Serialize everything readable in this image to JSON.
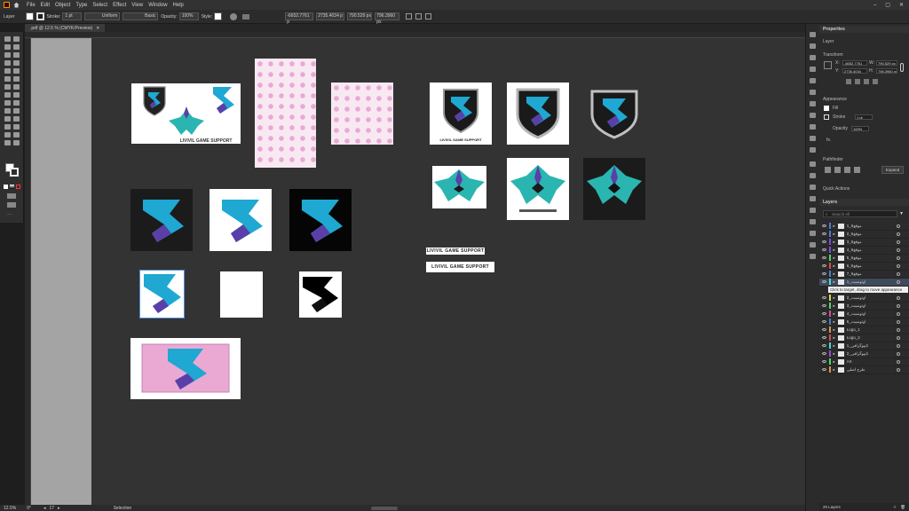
{
  "menu": {
    "app_icon": "illustrator-icon",
    "home_icon": "home-icon",
    "items": [
      "File",
      "Edit",
      "Object",
      "Type",
      "Select",
      "Effect",
      "View",
      "Window",
      "Help"
    ]
  },
  "control_bar": {
    "selection_label": "Layer",
    "stroke_label": "Stroke:",
    "stroke_value": "1 pt",
    "uniform_label": "Uniform",
    "basic_label": "Basic",
    "opacity_label": "Opacity:",
    "opacity_value": "100%",
    "style_label": "Style:",
    "x_value": "-6652.7761 p",
    "y_value": "2735.4034 p",
    "w_value": "790.529 px",
    "h_value": "796.3960 px"
  },
  "document": {
    "tab_title": ".pdf @ 12.5 % (CMYK/Preview)"
  },
  "canvas": {
    "label_small": "LIVIVIL GAME SUPPORT",
    "label_large": "LIVIVIL GAME SUPPORT",
    "banner_text": "LIVIVIL GAME SUPPORT",
    "shield_text": "LIVIVIL GAME SUPPORT"
  },
  "status_bar": {
    "zoom": "12.5%",
    "angle": "0°",
    "artboard": "17",
    "tool": "Selection"
  },
  "properties_panel": {
    "tab": "Properties",
    "layer_heading": "Layer",
    "transform_heading": "Transform",
    "x_label": "X:",
    "x_value": "-6652.7761",
    "y_label": "Y:",
    "y_value": "2735.4034",
    "w_label": "W:",
    "w_value": "790.529 px",
    "h_label": "H:",
    "h_value": "796.3960 px",
    "appearance_heading": "Appearance",
    "fill_label": "Fill",
    "stroke_label": "Stroke",
    "stroke_value": "1 pt",
    "opacity_label": "Opacity",
    "opacity_value": "100%",
    "fx_label": "fx.",
    "pathfinder_heading": "Pathfinder",
    "expand_button": "Expand",
    "quick_actions_heading": "Quick Actions"
  },
  "layers_panel": {
    "tab": "Layers",
    "search_placeholder": "Search All",
    "footer_count": "20 Layers",
    "tooltip": "Click to target, drag to move appearance",
    "rows": [
      {
        "name": "موقع6_1",
        "color": "#4a7bd8"
      },
      {
        "name": "موقع6_2",
        "color": "#4a7bd8"
      },
      {
        "name": "موقع6_3",
        "color": "#7c4ad8"
      },
      {
        "name": "موقع6_4",
        "color": "#7c4ad8"
      },
      {
        "name": "موقع6_5",
        "color": "#4ad86c"
      },
      {
        "name": "موقع6_6",
        "color": "#d84a4a"
      },
      {
        "name": "موقع6_7",
        "color": "#4a7bd8"
      },
      {
        "name": "اوتوسيت_1",
        "color": "#4ad8d8"
      },
      {
        "name": "اوتوسيت_2",
        "color": "#d8d84a"
      },
      {
        "name": "اوتوسيت_3",
        "color": "#4ad86c"
      },
      {
        "name": "اوتوسيت_4",
        "color": "#d84a9a"
      },
      {
        "name": "اوتوسيت_5",
        "color": "#4a7bd8"
      },
      {
        "name": "Logo_1",
        "color": "#d8944a"
      },
      {
        "name": "Logo_2",
        "color": "#d84a4a"
      },
      {
        "name": "تايپوگرافی_1",
        "color": "#4ad8d8"
      },
      {
        "name": "تايپوگرافی_2",
        "color": "#9a4ad8"
      },
      {
        "name": "Art",
        "color": "#4ad86c"
      },
      {
        "name": "طرح اصلی",
        "color": "#d8944a"
      }
    ]
  },
  "colors": {
    "accent": "#4a90e2",
    "logo_teal": "#1fa8d2",
    "logo_purple": "#5a3fa8",
    "wings_teal": "#2ab5b0",
    "pink_bg": "#e9a9d3"
  }
}
